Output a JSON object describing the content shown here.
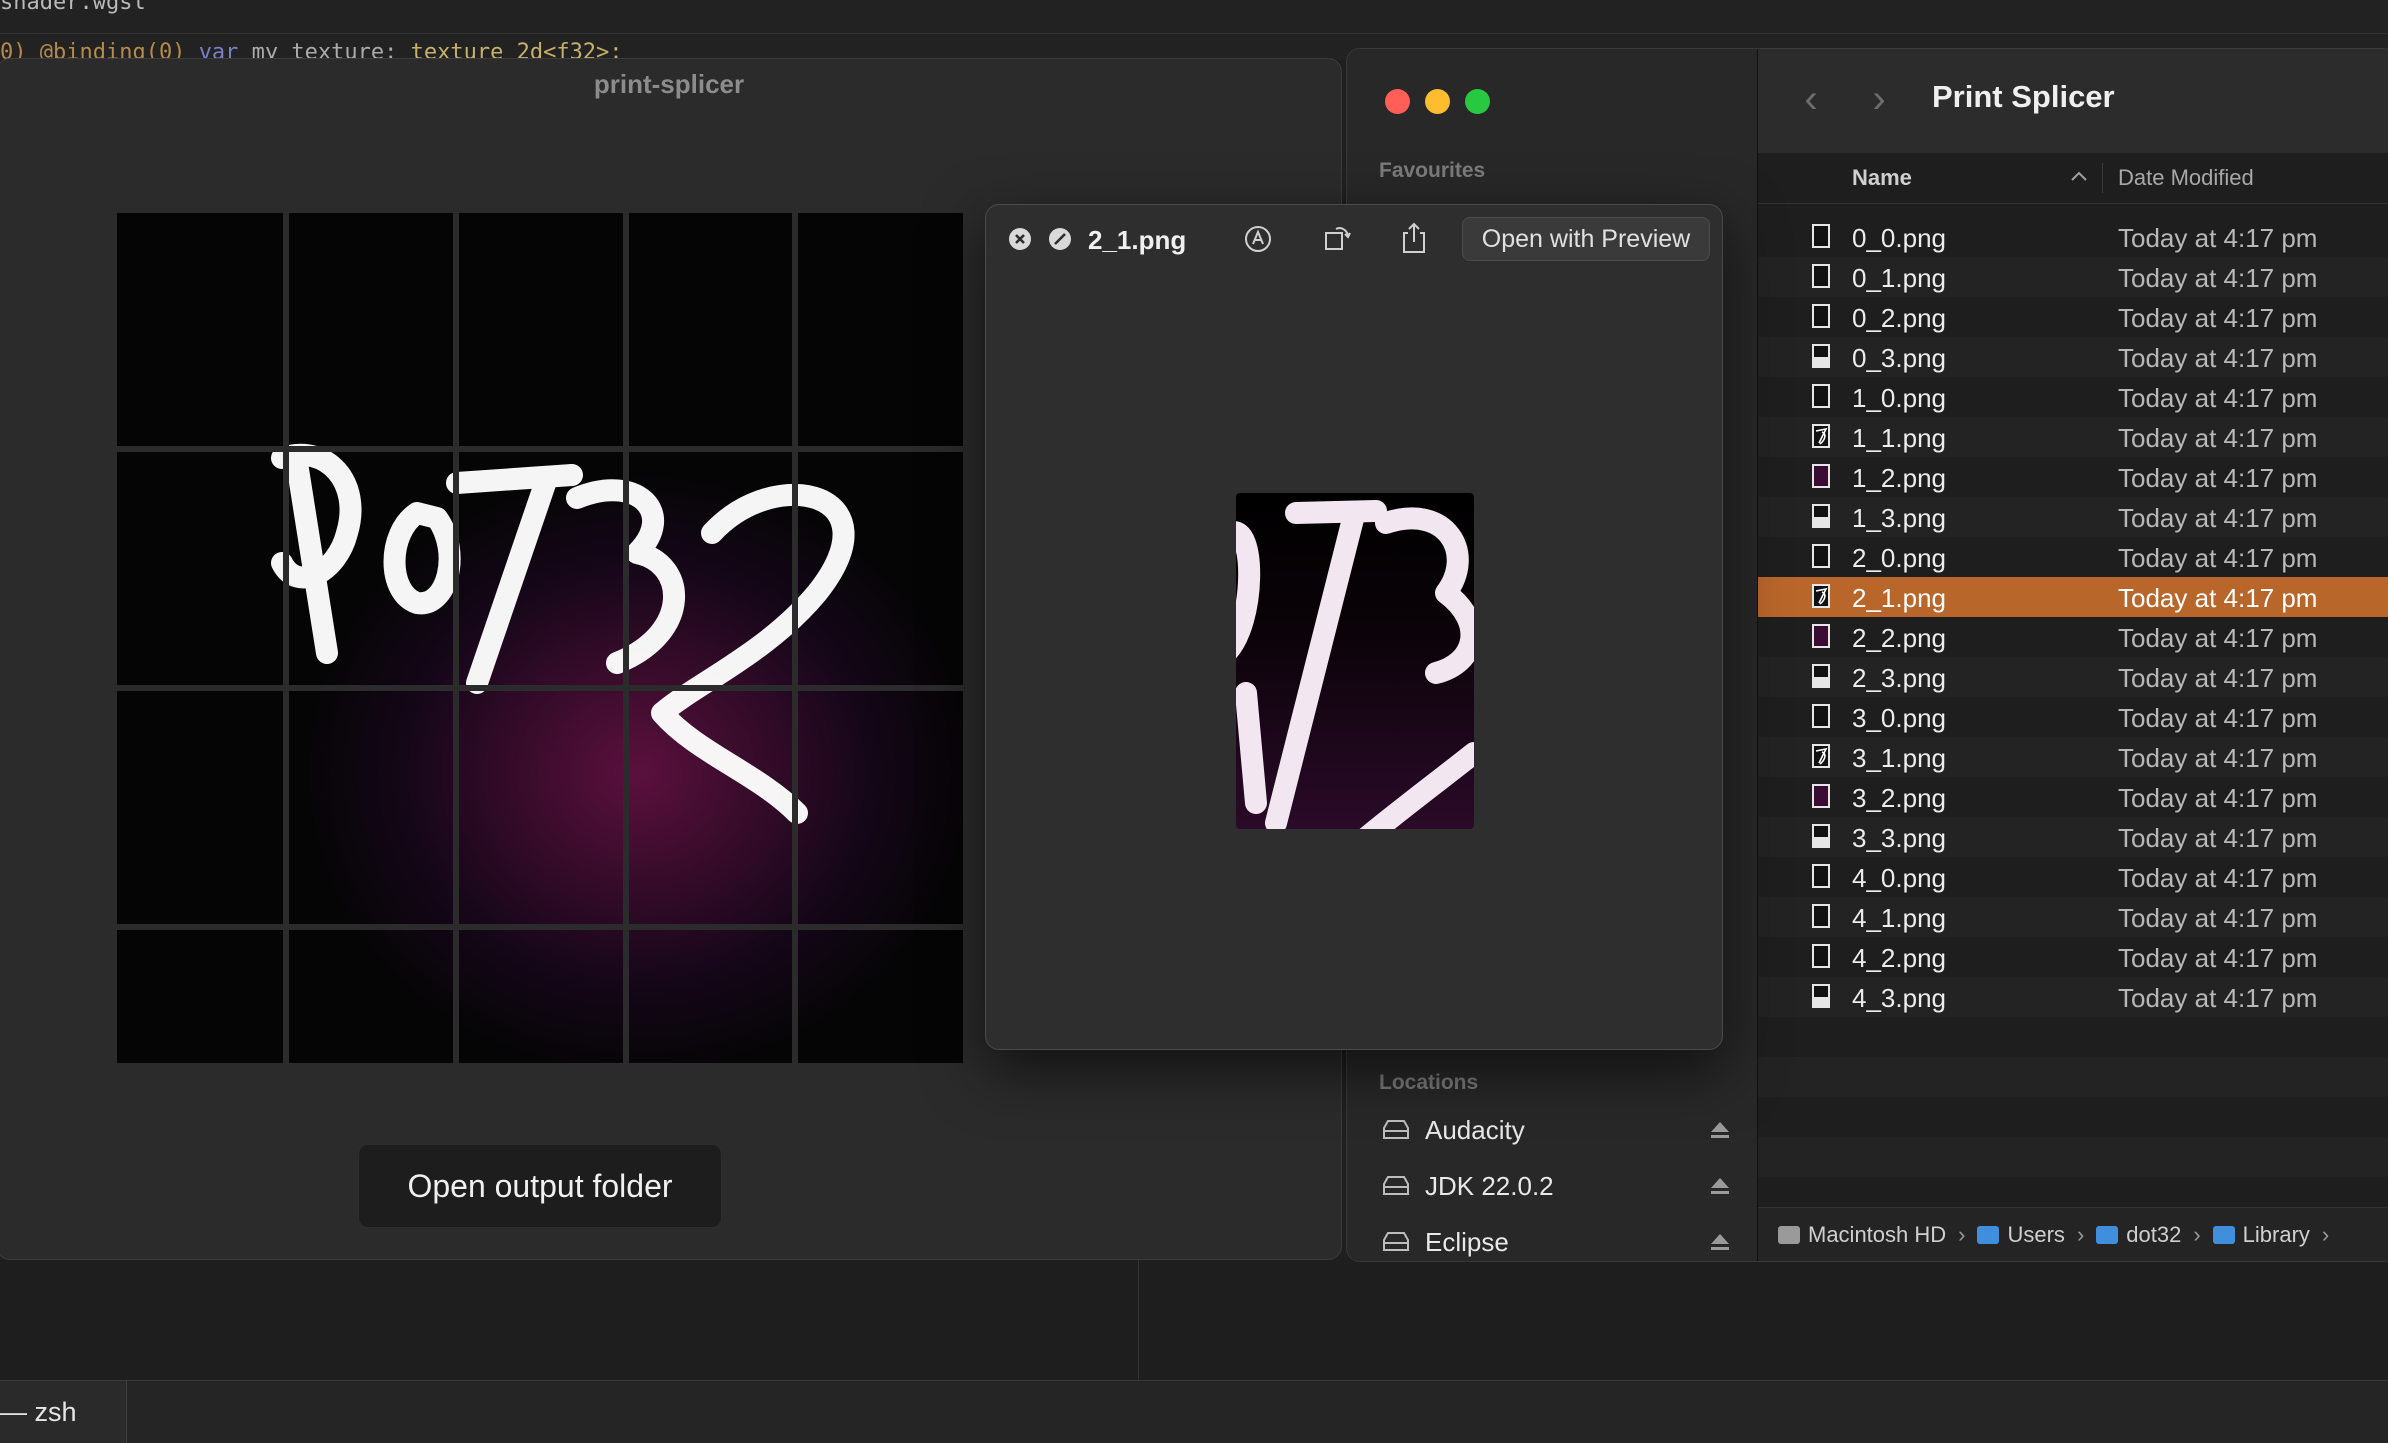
{
  "editor": {
    "line1": "shader.wgsl",
    "line2_prefix": "0) @binding(0) ",
    "line2_kw": "var ",
    "line2_name": "my_texture: ",
    "line2_type": "texture_2d<f32>;"
  },
  "terminal": {
    "tab_label": "— zsh"
  },
  "app": {
    "title": "print-splicer",
    "open_output_label": "Open output folder",
    "grid": {
      "columns": 5,
      "rows": 4
    }
  },
  "finder": {
    "sidebar": {
      "favourites_header": "Favourites",
      "locations_header": "Locations",
      "locations": [
        {
          "label": "Audacity"
        },
        {
          "label": "JDK 22.0.2"
        },
        {
          "label": "Eclipse"
        }
      ]
    },
    "title": "Print Splicer",
    "columns": {
      "name": "Name",
      "date": "Date Modified"
    },
    "files": [
      {
        "name": "0_0.png",
        "date": "Today at 4:17 pm",
        "thumb": "empty"
      },
      {
        "name": "0_1.png",
        "date": "Today at 4:17 pm",
        "thumb": "empty"
      },
      {
        "name": "0_2.png",
        "date": "Today at 4:17 pm",
        "thumb": "empty"
      },
      {
        "name": "0_3.png",
        "date": "Today at 4:17 pm",
        "thumb": "bottom"
      },
      {
        "name": "1_0.png",
        "date": "Today at 4:17 pm",
        "thumb": "empty"
      },
      {
        "name": "1_1.png",
        "date": "Today at 4:17 pm",
        "thumb": "scribble"
      },
      {
        "name": "1_2.png",
        "date": "Today at 4:17 pm",
        "thumb": "purple"
      },
      {
        "name": "1_3.png",
        "date": "Today at 4:17 pm",
        "thumb": "bottom"
      },
      {
        "name": "2_0.png",
        "date": "Today at 4:17 pm",
        "thumb": "empty"
      },
      {
        "name": "2_1.png",
        "date": "Today at 4:17 pm",
        "thumb": "scribble",
        "selected": true
      },
      {
        "name": "2_2.png",
        "date": "Today at 4:17 pm",
        "thumb": "purple"
      },
      {
        "name": "2_3.png",
        "date": "Today at 4:17 pm",
        "thumb": "bottom"
      },
      {
        "name": "3_0.png",
        "date": "Today at 4:17 pm",
        "thumb": "empty"
      },
      {
        "name": "3_1.png",
        "date": "Today at 4:17 pm",
        "thumb": "scribble"
      },
      {
        "name": "3_2.png",
        "date": "Today at 4:17 pm",
        "thumb": "purple"
      },
      {
        "name": "3_3.png",
        "date": "Today at 4:17 pm",
        "thumb": "bottom"
      },
      {
        "name": "4_0.png",
        "date": "Today at 4:17 pm",
        "thumb": "empty"
      },
      {
        "name": "4_1.png",
        "date": "Today at 4:17 pm",
        "thumb": "empty"
      },
      {
        "name": "4_2.png",
        "date": "Today at 4:17 pm",
        "thumb": "empty"
      },
      {
        "name": "4_3.png",
        "date": "Today at 4:17 pm",
        "thumb": "bottom"
      }
    ],
    "path": [
      "Macintosh HD",
      "Users",
      "dot32",
      "Library"
    ],
    "selected_color": "#b9662b"
  },
  "quicklook": {
    "filename": "2_1.png",
    "open_with_label": "Open with Preview"
  },
  "colors": {
    "close": "#ff5f57",
    "minimize": "#febc2e",
    "zoom": "#28c840"
  }
}
